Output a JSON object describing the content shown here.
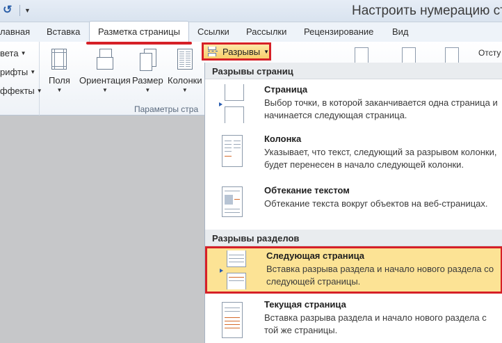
{
  "window": {
    "title": "Настроить нумерацию стр"
  },
  "tabs": [
    {
      "label": "лавная"
    },
    {
      "label": "Вставка"
    },
    {
      "label": "Разметка страницы",
      "active": true
    },
    {
      "label": "Ссылки"
    },
    {
      "label": "Рассылки"
    },
    {
      "label": "Рецензирование"
    },
    {
      "label": "Вид"
    }
  ],
  "ribbon": {
    "left_group": {
      "items": [
        "вета",
        "рифты",
        "ффекты"
      ]
    },
    "buttons": {
      "fields": "Поля",
      "orientation": "Ориентация",
      "size": "Размер",
      "columns": "Колонки"
    },
    "group_label": "Параметры стра",
    "breaks_label": "Разрывы",
    "indent_label": "Отсту"
  },
  "menu": {
    "page_breaks_header": "Разрывы страниц",
    "section_breaks_header": "Разрывы разделов",
    "items": [
      {
        "title": "Страница",
        "desc": "Выбор точки, в которой заканчивается одна страница и начинается следующая страница."
      },
      {
        "title": "Колонка",
        "desc": "Указывает, что текст, следующий за разрывом колонки, будет перенесен в начало следующей колонки."
      },
      {
        "title": "Обтекание текстом",
        "desc": "Обтекание текста вокруг объектов на веб-страницах."
      },
      {
        "title": "Следующая страница",
        "desc": "Вставка разрыва раздела и начало нового раздела со следующей страницы."
      },
      {
        "title": "Текущая страница",
        "desc": "Вставка разрыва раздела и начало нового раздела с той же страницы."
      }
    ]
  },
  "colors": {
    "highlight": "#fce395",
    "callout": "#d62027"
  }
}
